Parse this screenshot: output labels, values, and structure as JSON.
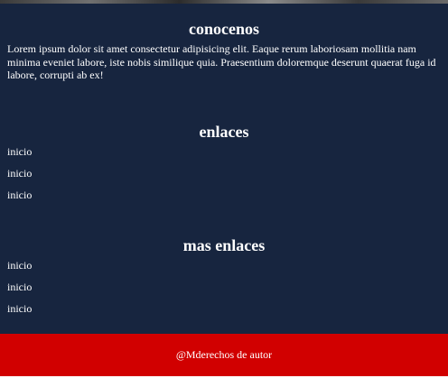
{
  "sections": {
    "about": {
      "title": "conocenos",
      "text": "Lorem ipsum dolor sit amet consectetur adipisicing elit. Eaque rerum laboriosam mollitia nam minima eveniet labore, iste nobis similique quia. Praesentium doloremque deserunt quaerat fuga id labore, corrupti ab ex!"
    },
    "links": {
      "title": "enlaces",
      "items": [
        "inicio",
        "inicio",
        "inicio"
      ]
    },
    "more_links": {
      "title": "mas enlaces",
      "items": [
        "inicio",
        "inicio",
        "inicio"
      ]
    }
  },
  "footer": {
    "text": "@Mderechos de autor"
  },
  "colors": {
    "panel_background": "#17253f",
    "footer_background": "#d10000",
    "text": "#ffffff"
  }
}
